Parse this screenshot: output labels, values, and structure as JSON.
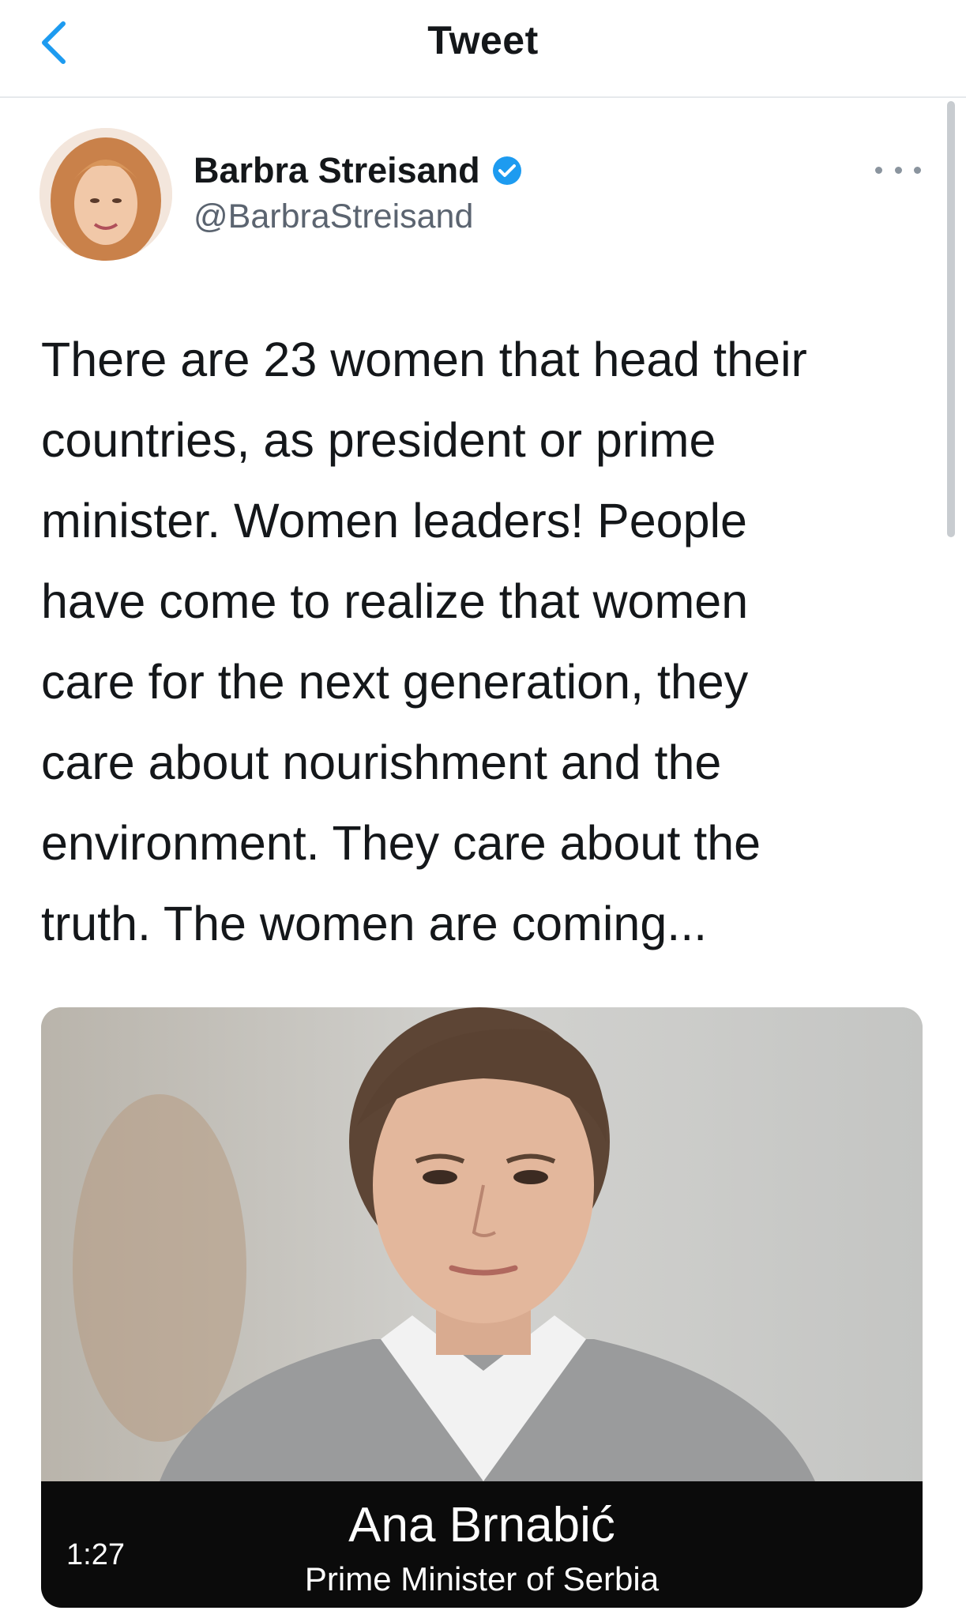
{
  "header": {
    "title": "Tweet",
    "back_icon": "chevron-left-icon"
  },
  "colors": {
    "accent": "#1d9bf0",
    "text": "#14171a",
    "muted": "#5b6470",
    "divider": "#e6e9ec"
  },
  "author": {
    "name": "Barbra Streisand",
    "handle": "@BarbraStreisand",
    "verified": true
  },
  "tweet": {
    "text": "There are 23 women that head their\ncountries, as president or prime\nminister. Women leaders! People\nhave come to realize that women\ncare for the next generation, they\ncare about nourishment and the\nenvironment. They care about the\ntruth. The women are coming..."
  },
  "media": {
    "type": "video",
    "caption_name": "Ana Brnabić",
    "caption_role": "Prime Minister of Serbia",
    "duration": "1:27"
  }
}
